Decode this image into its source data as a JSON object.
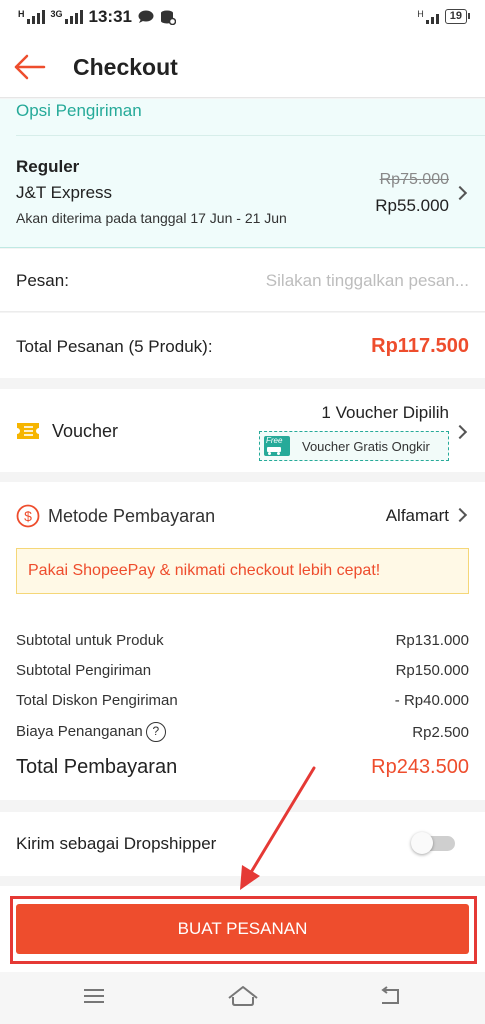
{
  "status_bar": {
    "network_left": "H",
    "network_3g": "3G",
    "time": "13:31",
    "network_right": "H",
    "battery": "19"
  },
  "header": {
    "title": "Checkout",
    "back_icon": "arrow-left-icon",
    "accent_color": "#ee4d2d"
  },
  "shipping": {
    "section_label": "Opsi Pengiriman",
    "type": "Reguler",
    "courier": "J&T Express",
    "eta": "Akan diterima pada tanggal 17 Jun - 21 Jun",
    "old_price": "Rp75.000",
    "new_price": "Rp55.000",
    "accent_color": "#26aa99"
  },
  "message": {
    "label": "Pesan:",
    "value": "",
    "placeholder": "Silakan tinggalkan pesan..."
  },
  "order_total": {
    "label": "Total Pesanan (5 Produk):",
    "value": "Rp117.500"
  },
  "voucher": {
    "label": "Voucher",
    "selected": "1 Voucher Dipilih",
    "tag_badge": "Free",
    "tag_text": "Voucher Gratis Ongkir",
    "icon": "ticket-icon"
  },
  "payment": {
    "label": "Metode Pembayaran",
    "value": "Alfamart",
    "icon": "dollar-circle-icon",
    "promo": "Pakai ShopeePay & nikmati checkout lebih cepat!"
  },
  "summary": {
    "rows": [
      {
        "label": "Subtotal untuk Produk",
        "value": "Rp131.000"
      },
      {
        "label": "Subtotal Pengiriman",
        "value": "Rp150.000"
      },
      {
        "label": "Total Diskon Pengiriman",
        "value": "- Rp40.000"
      },
      {
        "label": "Biaya Penanganan",
        "value": "Rp2.500"
      }
    ],
    "help_glyph": "?",
    "total_label": "Total Pembayaran",
    "total_value": "Rp243.500"
  },
  "dropshipper": {
    "label": "Kirim sebagai Dropshipper",
    "enabled": false
  },
  "cta": {
    "label": "BUAT PESANAN",
    "annotation_color": "#e53935"
  }
}
